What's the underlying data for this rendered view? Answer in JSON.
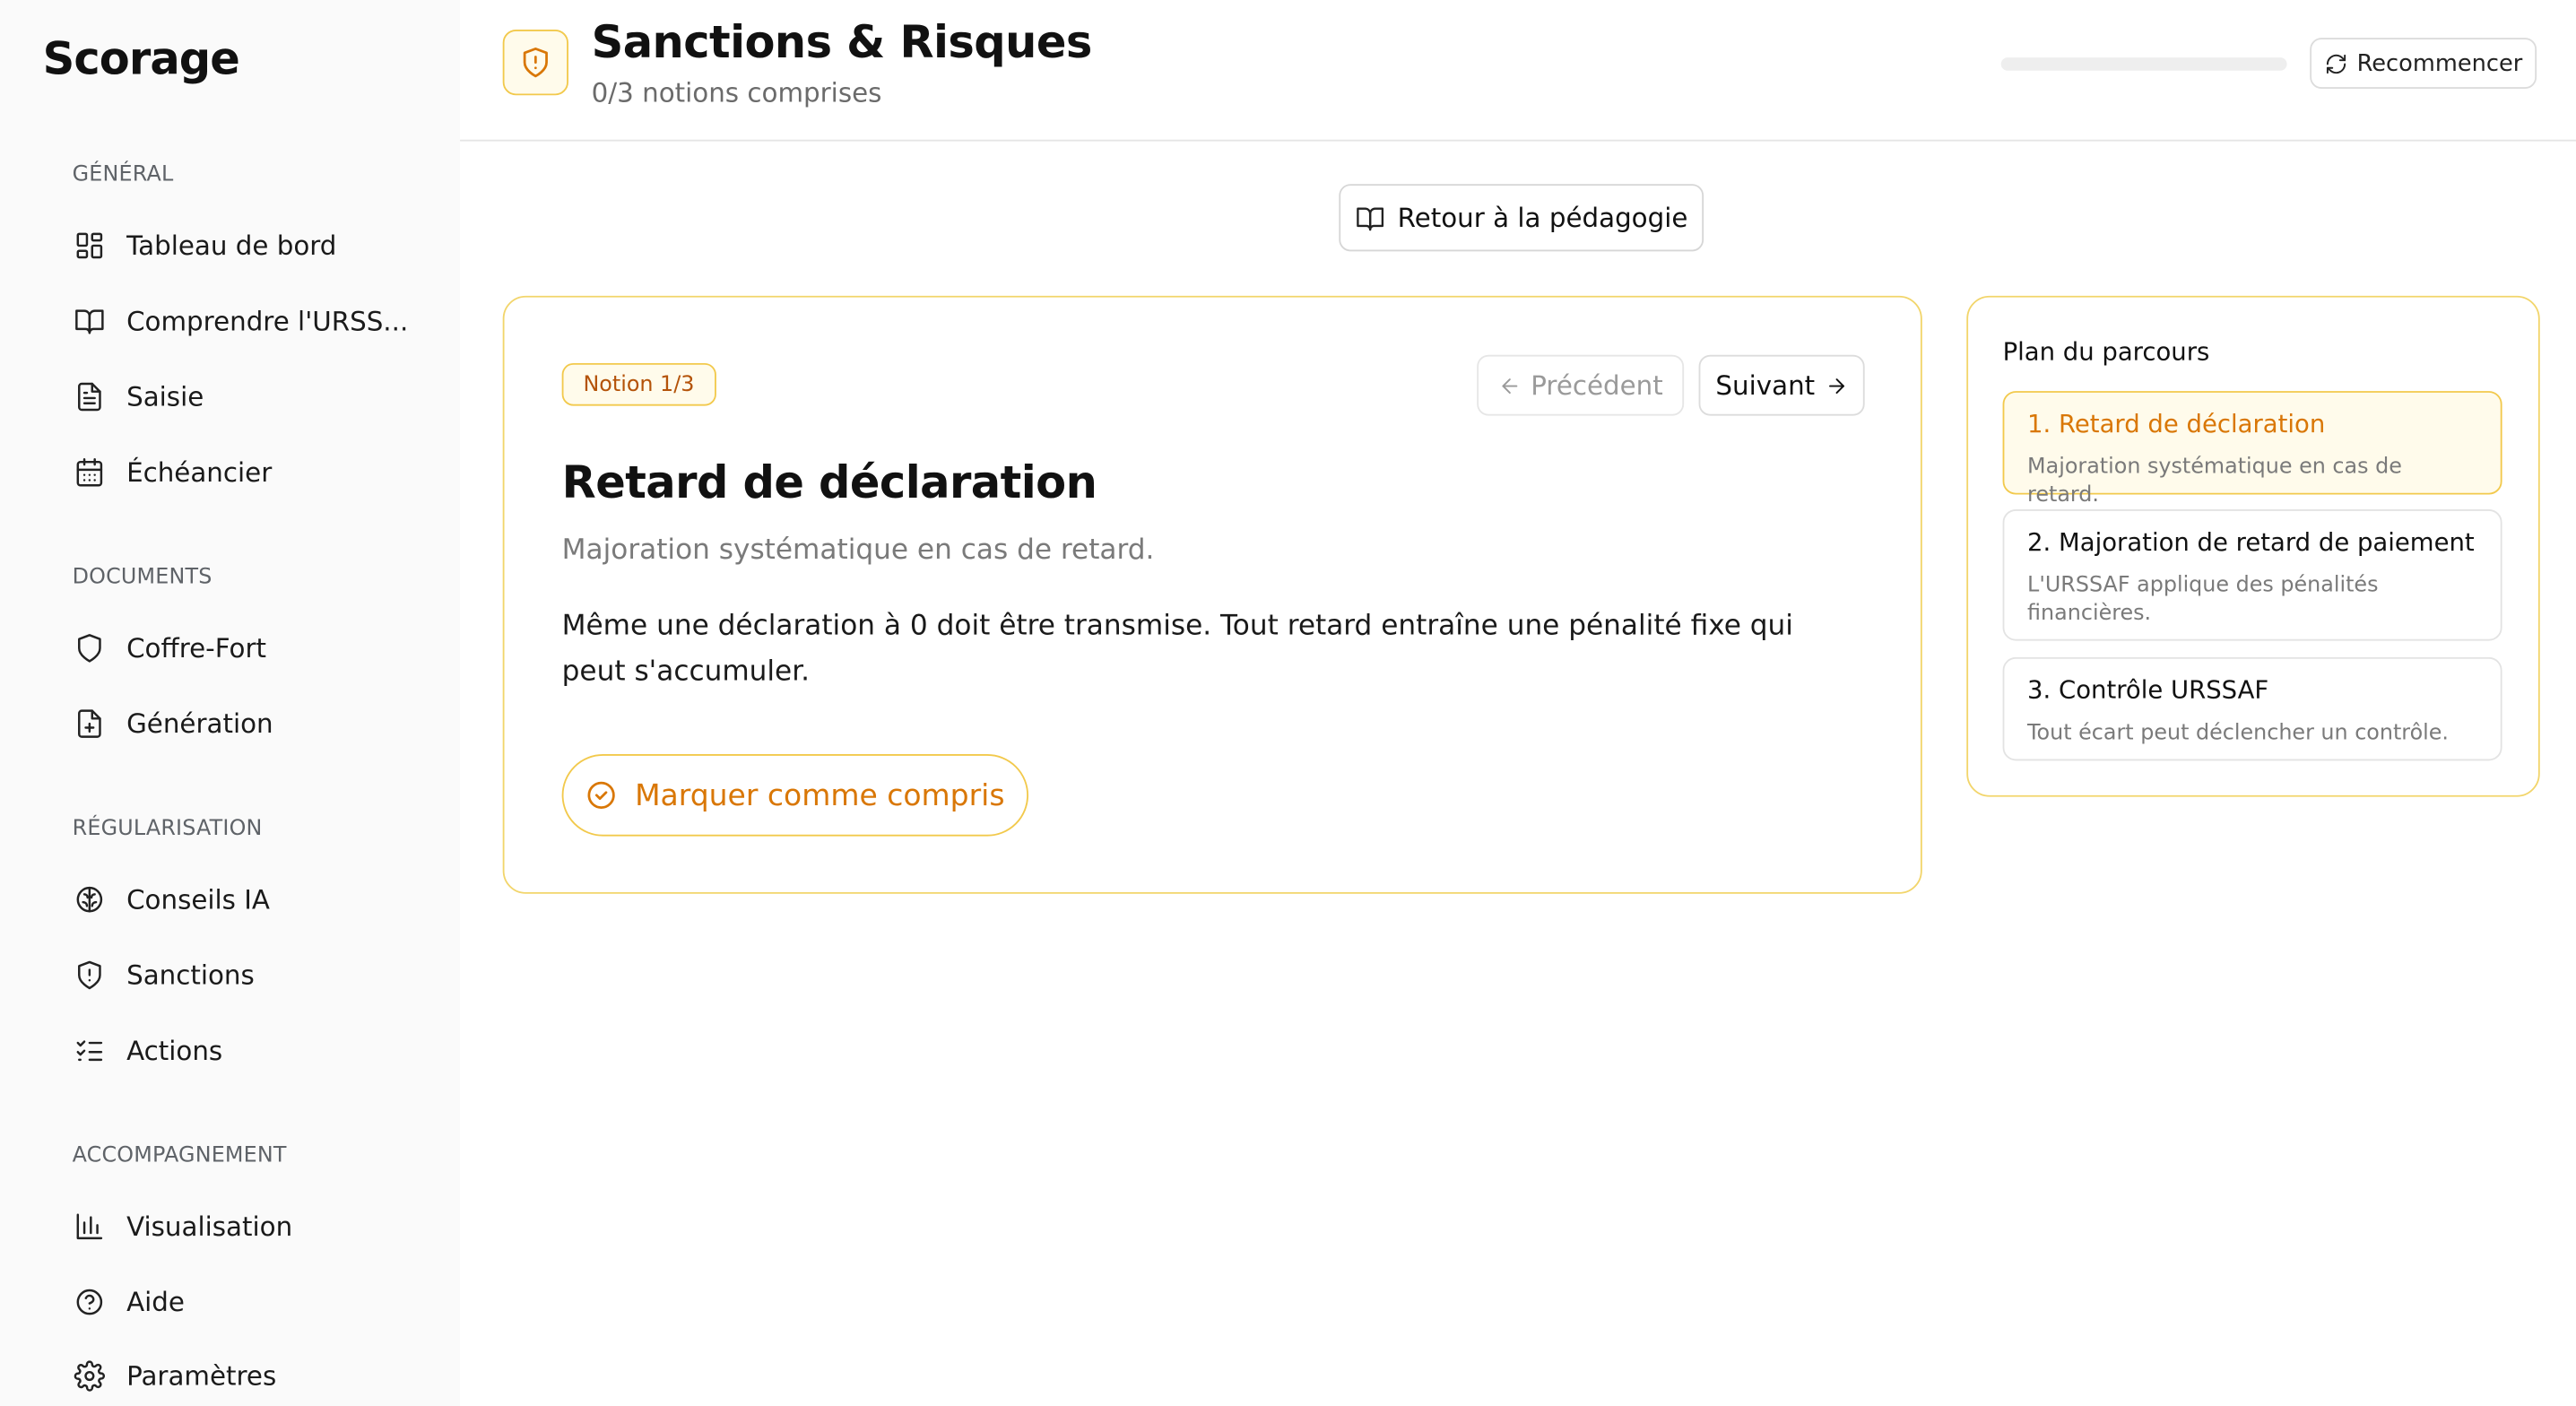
{
  "app": {
    "brand": "Scorage"
  },
  "sidebar": {
    "sections": [
      {
        "label": "GÉNÉRAL",
        "items": [
          {
            "label": "Tableau de bord",
            "icon": "dashboard-icon"
          },
          {
            "label": "Comprendre l'URSS...",
            "icon": "book-icon"
          },
          {
            "label": "Saisie",
            "icon": "document-icon"
          },
          {
            "label": "Échéancier",
            "icon": "calendar-icon"
          }
        ]
      },
      {
        "label": "DOCUMENTS",
        "items": [
          {
            "label": "Coffre-Fort",
            "icon": "shield-icon"
          },
          {
            "label": "Génération",
            "icon": "file-plus-icon"
          }
        ]
      },
      {
        "label": "RÉGULARISATION",
        "items": [
          {
            "label": "Conseils IA",
            "icon": "brain-icon"
          },
          {
            "label": "Sanctions",
            "icon": "shield-alert-icon"
          },
          {
            "label": "Actions",
            "icon": "list-checks-icon"
          }
        ]
      },
      {
        "label": "ACCOMPAGNEMENT",
        "items": [
          {
            "label": "Visualisation",
            "icon": "bar-chart-icon"
          },
          {
            "label": "Aide",
            "icon": "help-circle-icon"
          },
          {
            "label": "Paramètres",
            "icon": "gear-icon"
          }
        ]
      }
    ]
  },
  "header": {
    "title": "Sanctions & Risques",
    "subtitle": "0/3 notions comprises",
    "progress": 0,
    "restart_label": "Recommencer",
    "accent": "#d97706"
  },
  "back_button": {
    "label": "Retour à la pédagogie"
  },
  "notion": {
    "badge": "Notion 1/3",
    "prev_label": "Précédent",
    "next_label": "Suivant",
    "title": "Retard de déclaration",
    "subtitle": "Majoration systématique en cas de retard.",
    "body": "Même une déclaration à 0 doit être transmise. Tout retard entraîne une pénalité fixe qui peut s'accumuler.",
    "mark_label": "Marquer comme compris"
  },
  "plan": {
    "title": "Plan du parcours",
    "items": [
      {
        "title": "1. Retard de déclaration",
        "desc": "Majoration systématique en cas de retard."
      },
      {
        "title": "2. Majoration de retard de paiement",
        "desc": "L'URSSAF applique des pénalités financières."
      },
      {
        "title": "3. Contrôle URSSAF",
        "desc": "Tout écart peut déclencher un contrôle."
      }
    ]
  }
}
